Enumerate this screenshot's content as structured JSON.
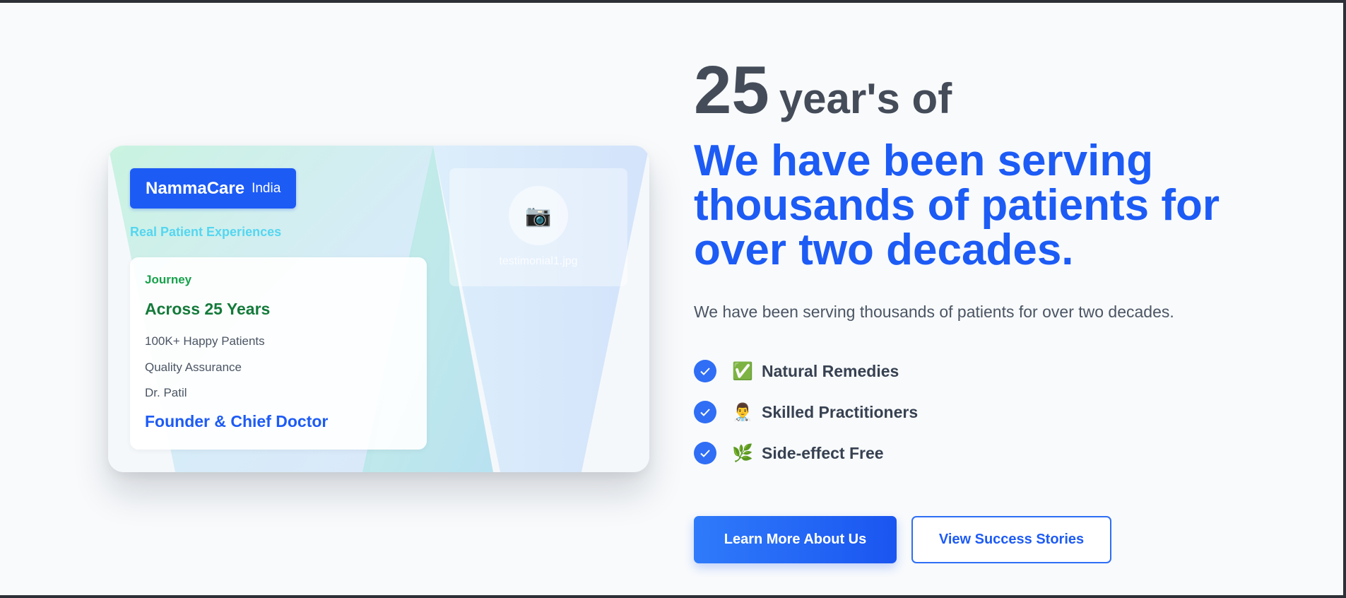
{
  "card": {
    "brand_name": "NammaCare",
    "brand_country": "India",
    "subtitle": "Real Patient Experiences",
    "info": {
      "label": "Journey",
      "heading": "Across 25 Years",
      "lines": [
        "100K+ Happy Patients",
        "Quality Assurance",
        "Dr. Patil"
      ],
      "role": "Founder & Chief Doctor"
    },
    "photo": {
      "icon": "camera-icon",
      "glyph": "📷",
      "filename": "testimonial1.jpg"
    }
  },
  "hero": {
    "years_number": "25",
    "years_text": "year's of",
    "headline": "We have been serving thousands of patients for over two decades.",
    "description": "We have been serving thousands of patients for over two decades."
  },
  "features": [
    {
      "emoji": "✅",
      "icon": "check-box-icon",
      "label": "Natural Remedies"
    },
    {
      "emoji": "👨‍⚕️",
      "icon": "doctor-icon",
      "label": "Skilled Practitioners"
    },
    {
      "emoji": "🌿",
      "icon": "herb-icon",
      "label": "Side-effect Free"
    }
  ],
  "buttons": {
    "primary": "Learn More About Us",
    "secondary": "View Success Stories"
  },
  "colors": {
    "accent": "#1d5bf5",
    "heading": "#454c59",
    "journey_green": "#17a14b",
    "subtitle_cyan": "#55d6f0"
  }
}
